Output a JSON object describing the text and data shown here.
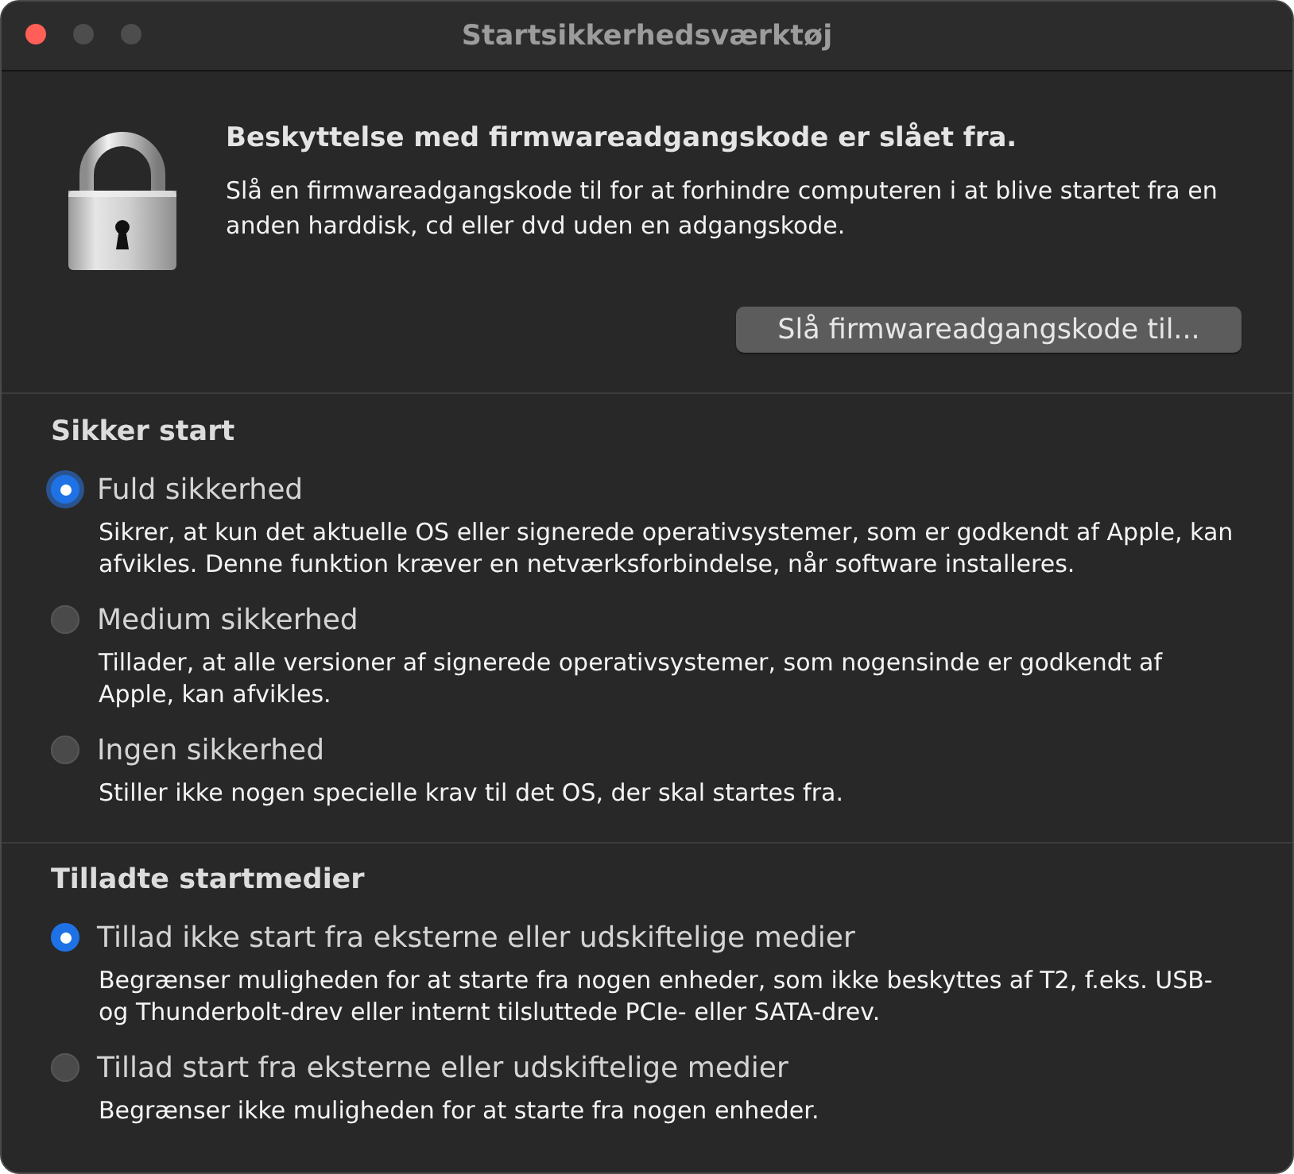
{
  "window": {
    "title": "Startsikkerhedsværktøj",
    "buttons": [
      {
        "kind": "close",
        "disabled": false
      },
      {
        "kind": "minimize",
        "disabled": true
      },
      {
        "kind": "zoom",
        "disabled": true
      }
    ]
  },
  "firmware": {
    "heading": "Beskyttelse med firmwareadgangskode er slået fra.",
    "description": "Slå en firmwareadgangskode til for at forhindre computeren i at blive startet fra en anden harddisk, cd eller dvd uden en adgangskode.",
    "button": "Slå firmwareadgangskode til..."
  },
  "sections": [
    {
      "title": "Sikker start",
      "options": [
        {
          "label": "Fuld sikkerhed",
          "description": "Sikrer, at kun det aktuelle OS eller signerede operativsystemer, som er godkendt af Apple, kan afvikles. Denne funktion kræver en netværksforbindelse, når software installeres.",
          "selected": true,
          "focused": true
        },
        {
          "label": "Medium sikkerhed",
          "description": "Tillader, at alle versioner af signerede operativsystemer, som nogensinde er godkendt af Apple, kan afvikles.",
          "selected": false,
          "focused": false
        },
        {
          "label": "Ingen sikkerhed",
          "description": "Stiller ikke nogen specielle krav til det OS, der skal startes fra.",
          "selected": false,
          "focused": false
        }
      ]
    },
    {
      "title": "Tilladte startmedier",
      "options": [
        {
          "label": "Tillad ikke start fra eksterne eller udskiftelige medier",
          "description": "Begrænser muligheden for at starte fra nogen enheder, som ikke beskyttes af T2, f.eks. USB- og Thunderbolt-drev eller internt tilsluttede PCIe- eller SATA-drev.",
          "selected": true,
          "focused": false
        },
        {
          "label": "Tillad start fra eksterne eller udskiftelige medier",
          "description": "Begrænser ikke muligheden for at starte fra nogen enheder.",
          "selected": false,
          "focused": false
        }
      ]
    }
  ]
}
